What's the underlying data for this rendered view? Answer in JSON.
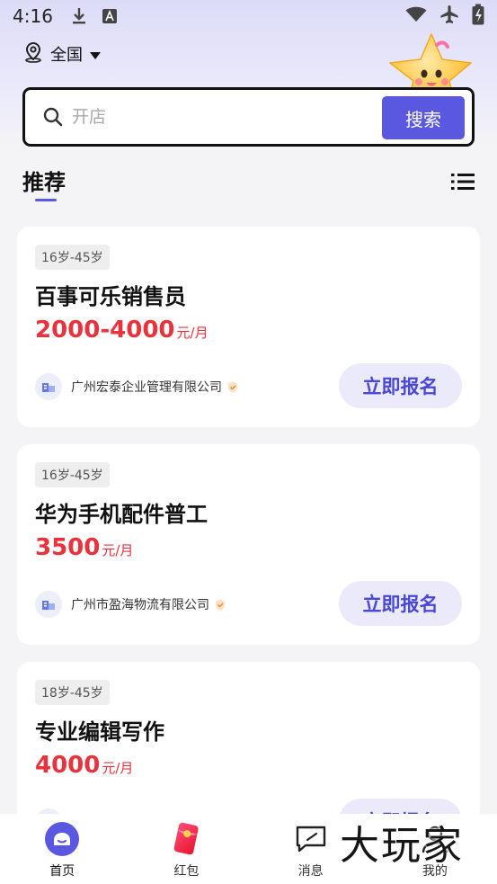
{
  "status_bar": {
    "time": "4:16"
  },
  "location": {
    "label": "全国"
  },
  "search": {
    "placeholder": "开店",
    "button_label": "搜索"
  },
  "section": {
    "title": "推荐"
  },
  "jobs": [
    {
      "age": "16岁-45岁",
      "title": "百事可乐销售员",
      "salary": "2000-4000",
      "salary_unit": "元/月",
      "company": "广州宏泰企业管理有限公司",
      "apply_label": "立即报名"
    },
    {
      "age": "16岁-45岁",
      "title": "华为手机配件普工",
      "salary": "3500",
      "salary_unit": "元/月",
      "company": "广州市盈海物流有限公司",
      "apply_label": "立即报名"
    },
    {
      "age": "18岁-45岁",
      "title": "专业编辑写作",
      "salary": "4000",
      "salary_unit": "元/月",
      "company": "",
      "apply_label": "立即报名"
    }
  ],
  "tabs": [
    {
      "label": "首页",
      "icon": "home-icon",
      "active": true
    },
    {
      "label": "红包",
      "icon": "red-envelope-icon",
      "active": false
    },
    {
      "label": "消息",
      "icon": "message-icon",
      "active": false
    },
    {
      "label": "我的",
      "icon": "profile-icon",
      "active": false
    }
  ],
  "watermark": {
    "text": "大玩家"
  },
  "colors": {
    "accent": "#5a57e0",
    "salary": "#e8323c",
    "apply_bg": "#ebeafb",
    "apply_text": "#4b48d6",
    "page_bg": "#f4f4f6",
    "header_bg": "#dcdcf7"
  }
}
